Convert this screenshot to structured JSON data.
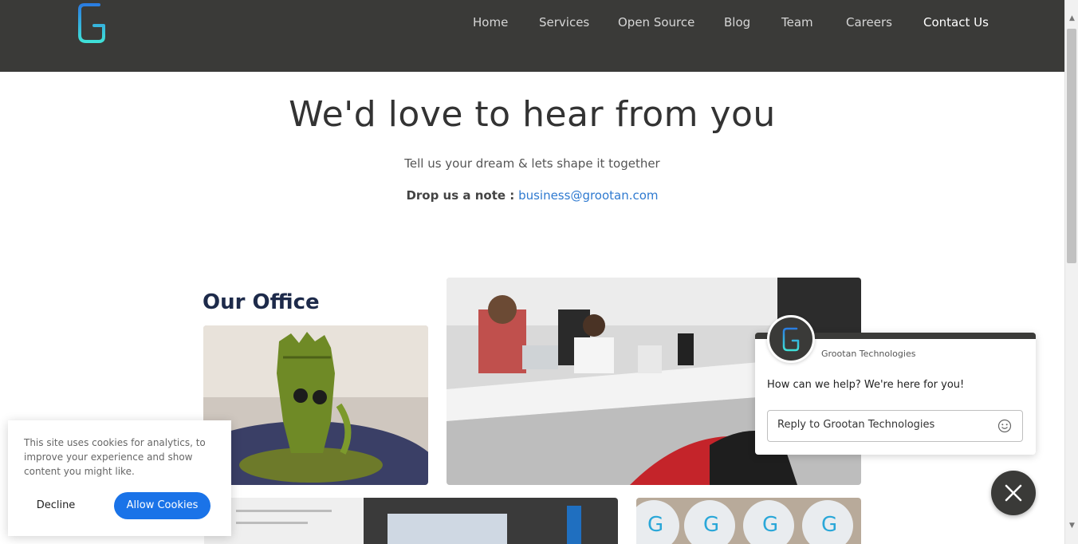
{
  "brand": {
    "logo_icon": "grootan-g-logo",
    "accent": "#3fd6e0"
  },
  "nav": {
    "items": [
      {
        "label": "Home"
      },
      {
        "label": "Services"
      },
      {
        "label": "Open Source"
      },
      {
        "label": "Blog"
      },
      {
        "label": "Team"
      },
      {
        "label": "Careers"
      },
      {
        "label": "Contact Us"
      }
    ],
    "active": "Contact Us"
  },
  "hero": {
    "title": "We'd love to hear from you",
    "subtitle": "Tell us your dream & lets shape it together",
    "note_label": "Drop us a note :",
    "email": "business@grootan.com"
  },
  "office": {
    "title": "Our Office",
    "photos": [
      {
        "name": "groot-figurine-photo"
      },
      {
        "name": "office-desk-photo"
      },
      {
        "name": "whiteboard-photo"
      },
      {
        "name": "grootan-cupcakes-photo"
      }
    ]
  },
  "chat": {
    "company": "Grootan Technologies",
    "message": "How can we help? We're here for you!",
    "reply_placeholder": "Reply to Grootan Technologies",
    "emoji_icon": "smiley-icon",
    "close_icon": "close-icon"
  },
  "cookie": {
    "text": "This site uses cookies for analytics, to improve your experience and show content you might like.",
    "decline_label": "Decline",
    "allow_label": "Allow Cookies",
    "allow_color": "#1a73e8"
  }
}
